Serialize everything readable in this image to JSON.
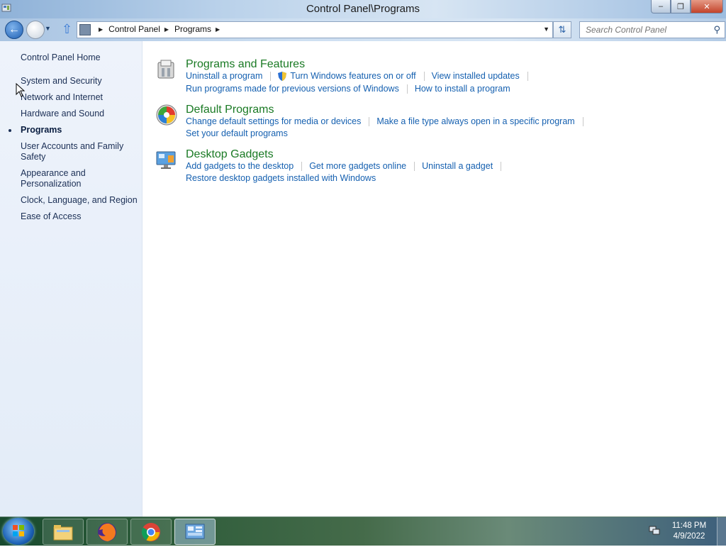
{
  "window": {
    "title": "Control Panel\\Programs",
    "controls": {
      "minimize": "–",
      "maximize": "❐",
      "close": "✕"
    }
  },
  "navbar": {
    "breadcrumbs": [
      "Control Panel",
      "Programs"
    ],
    "search_placeholder": "Search Control Panel"
  },
  "sidebar": {
    "home": "Control Panel Home",
    "items": [
      {
        "label": "System and Security",
        "active": false
      },
      {
        "label": "Network and Internet",
        "active": false
      },
      {
        "label": "Hardware and Sound",
        "active": false
      },
      {
        "label": "Programs",
        "active": true
      },
      {
        "label": "User Accounts and Family Safety",
        "active": false
      },
      {
        "label": "Appearance and Personalization",
        "active": false
      },
      {
        "label": "Clock, Language, and Region",
        "active": false
      },
      {
        "label": "Ease of Access",
        "active": false
      }
    ]
  },
  "categories": [
    {
      "title": "Programs and Features",
      "icon": "programs-features-icon",
      "rows": [
        [
          "Uninstall a program",
          "Turn Windows features on or off",
          "View installed updates"
        ],
        [
          "Run programs made for previous versions of Windows",
          "How to install a program"
        ]
      ]
    },
    {
      "title": "Default Programs",
      "icon": "default-programs-icon",
      "rows": [
        [
          "Change default settings for media or devices",
          "Make a file type always open in a specific program"
        ],
        [
          "Set your default programs"
        ]
      ]
    },
    {
      "title": "Desktop Gadgets",
      "icon": "desktop-gadgets-icon",
      "rows": [
        [
          "Add gadgets to the desktop",
          "Get more gadgets online",
          "Uninstall a gadget"
        ],
        [
          "Restore desktop gadgets installed with Windows"
        ]
      ]
    }
  ],
  "taskbar": {
    "items": [
      "windows-explorer",
      "firefox",
      "chrome",
      "control-panel"
    ],
    "time": "11:48 PM",
    "date": "4/9/2022"
  },
  "colors": {
    "category_title": "#1a7a24",
    "link": "#1560b0",
    "sidebar_bg": "#e9f0fa"
  }
}
